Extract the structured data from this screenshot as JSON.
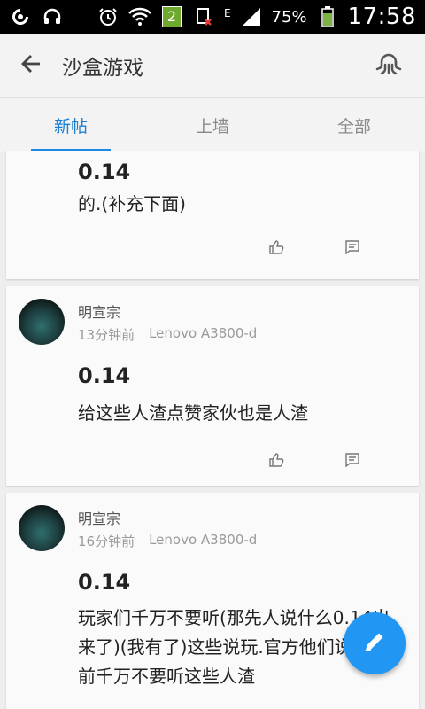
{
  "status_bar": {
    "sim_badge": "2",
    "network_label": "E",
    "battery": "75%",
    "time": "17:58"
  },
  "appbar": {
    "title": "沙盒游戏"
  },
  "tabs": [
    {
      "label": "新帖",
      "active": true
    },
    {
      "label": "上墙",
      "active": false
    },
    {
      "label": "全部",
      "active": false
    }
  ],
  "posts": [
    {
      "title": "0.14",
      "body": "的.(补充下面)"
    },
    {
      "author": "明宣宗",
      "time": "13分钟前",
      "device": "Lenovo A3800-d",
      "title": "0.14",
      "body": "给这些人渣点赞家伙也是人渣"
    },
    {
      "author": "明宣宗",
      "time": "16分钟前",
      "device": "Lenovo A3800-d",
      "title": "0.14",
      "body": "玩家们千万不要听(那先人说什么0.14出来了)(我有了)这些说玩.官方他们说0.14前千万不要听这些人渣"
    }
  ],
  "colors": {
    "accent": "#1e88e5",
    "fab": "#2196f3"
  },
  "icons": {
    "back": "arrow-left",
    "top_right": "octopus",
    "like": "thumbs-up",
    "comment": "comment",
    "fab": "pencil"
  }
}
